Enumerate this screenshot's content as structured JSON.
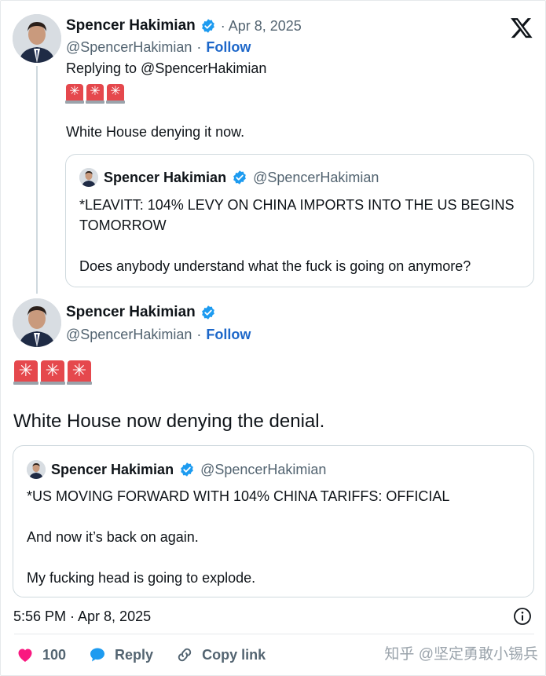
{
  "tweet1": {
    "name": "Spencer Hakimian",
    "date": "· Apr 8, 2025",
    "handle": "@SpencerHakimian",
    "follow_sep": "·",
    "follow": "Follow",
    "replying": "Replying to @SpencerHakimian",
    "text": "White House denying it now.",
    "quote": {
      "name": "Spencer Hakimian",
      "handle": "@SpencerHakimian",
      "p1": "*LEAVITT: 104% LEVY ON CHINA IMPORTS INTO THE US BEGINS TOMORROW",
      "p2": "Does anybody understand what the fuck is going on anymore?"
    }
  },
  "tweet2": {
    "name": "Spencer Hakimian",
    "handle": "@SpencerHakimian",
    "follow_sep": "·",
    "follow": "Follow",
    "text": "White House now denying the denial.",
    "quote": {
      "name": "Spencer Hakimian",
      "handle": "@SpencerHakimian",
      "p1": "*US MOVING FORWARD WITH 104% CHINA TARIFFS: OFFICIAL",
      "p2": "And now it’s back on again.",
      "p3": "My fucking head is going to explode."
    },
    "timestamp": "5:56 PM · Apr 8, 2025"
  },
  "actions": {
    "likes": "100",
    "reply": "Reply",
    "copy_link": "Copy link"
  },
  "watermark": "知乎 @坚定勇敢小锡兵",
  "colors": {
    "verified": "#1d9bf0",
    "follow": "#1d67c9",
    "heart": "#f91880",
    "reply_bubble": "#1d9bf0",
    "siren": "#e5484d"
  }
}
